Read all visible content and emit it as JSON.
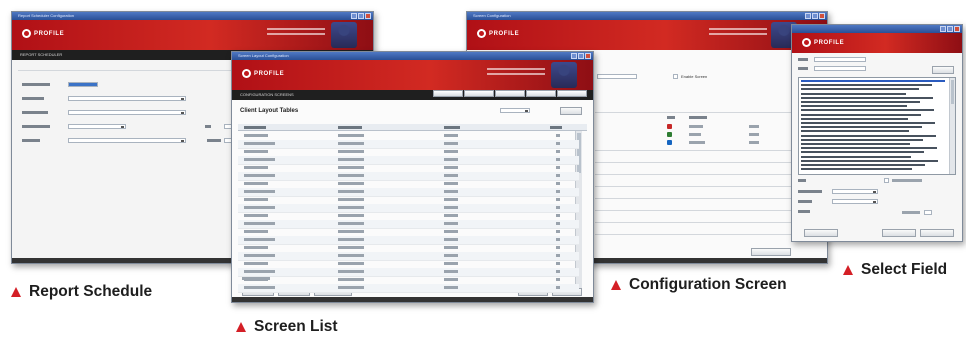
{
  "captions": {
    "report_schedule": "Report Schedule",
    "screen_list": "Screen List",
    "configuration_screen": "Configuration Screen",
    "select_field": "Select Field"
  },
  "colors": {
    "brand_red": "#c0181c",
    "caption_triangle": "#d41f26",
    "titlebar_blue": "#2a4f96",
    "highlight_blue": "#3b73c7"
  },
  "icons": {
    "caption_marker": "red-triangle-icon",
    "logo": "profile-logo-icon",
    "window_controls": "window-control-icons"
  },
  "screens": {
    "report_schedule": {
      "window_title": "Report Scheduler Configuration",
      "logo": "PROFILE",
      "section_title": "REPORT SCHEDULER"
    },
    "screen_list": {
      "window_title": "Screen Layout Configuration",
      "logo": "PROFILE",
      "section_title": "CONFIGURATION SCREENS",
      "panel_title": "Client Layout Tables"
    },
    "configuration_screen": {
      "window_title": "Screen Configuration",
      "logo": "PROFILE",
      "checkbox_label": "Enable Screen"
    },
    "select_field": {
      "logo": "PROFILE"
    }
  }
}
